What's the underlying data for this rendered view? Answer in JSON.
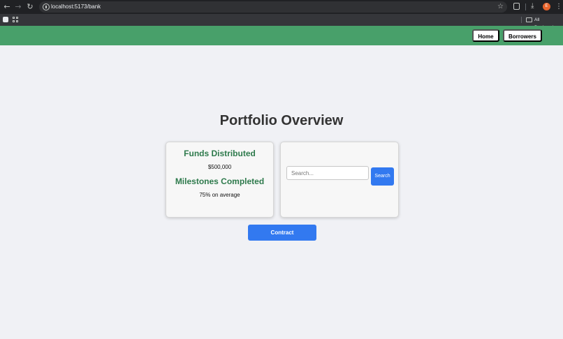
{
  "browser": {
    "url": "localhost:5173/bank",
    "bookmarks_label": "All Bookmarks",
    "profile_initial": "E",
    "icons": [
      "back-arrow-icon",
      "forward-arrow-icon",
      "reload-icon",
      "site-info-icon",
      "star-icon",
      "extensions-icon",
      "download-icon",
      "menu-dots-icon",
      "folder-icon"
    ]
  },
  "header": {
    "background": "#48a06a",
    "nav": {
      "home_label": "Home",
      "borrowers_label": "Borrowers"
    }
  },
  "main": {
    "title": "Portfolio Overview",
    "stats": [
      {
        "heading": "Funds Distributed",
        "value": "$500,000"
      },
      {
        "heading": "Milestones Completed",
        "value": "75% on average"
      }
    ],
    "search": {
      "placeholder": "Search...",
      "value": "",
      "button_label": "Search"
    },
    "contract_label": "Contract"
  },
  "colors": {
    "accent_green": "#2e7a4c",
    "button_blue": "#3279f0"
  }
}
